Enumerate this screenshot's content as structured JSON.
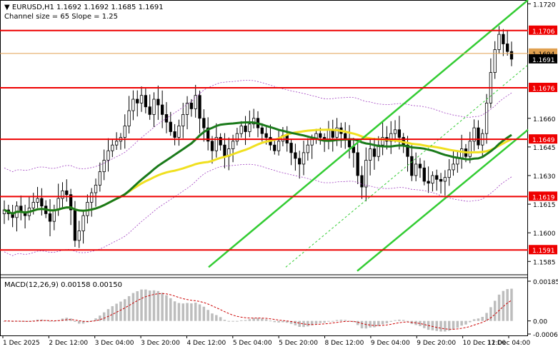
{
  "header": {
    "symbol_line": "▼ EURUSD,H1  1.1692 1.1692 1.1685 1.1691",
    "channel_line": "Channel size = 65 Slope = 1.25"
  },
  "macd_label": "MACD(12,26,9) 0.00158 0.00150",
  "price_scale": {
    "ticks": [
      "1.1720",
      "1.1660",
      "1.1645",
      "1.1630",
      "1.1615",
      "1.1600",
      "1.1585"
    ],
    "macd_ticks": [
      "0.00185",
      "0.00",
      "-0.00061"
    ]
  },
  "levels": [
    {
      "label": "1.1706",
      "value": 1.1706
    },
    {
      "label": "1.1676",
      "value": 1.1676
    },
    {
      "label": "1.1649",
      "value": 1.1649
    },
    {
      "label": "1.1619",
      "value": 1.1619
    },
    {
      "label": "1.1591",
      "value": 1.1591
    }
  ],
  "markers": [
    {
      "label": "1.1694",
      "value": 1.1694,
      "color": "#e0a050"
    },
    {
      "label": "1.1691",
      "value": 1.1691,
      "color": "#000000"
    }
  ],
  "time_axis": [
    "1 Dec 2025",
    "2 Dec 12:00",
    "3 Dec 04:00",
    "3 Dec 20:00",
    "4 Dec 12:00",
    "5 Dec 04:00",
    "5 Dec 20:00",
    "8 Dec 12:00",
    "9 Dec 04:00",
    "9 Dec 20:00",
    "10 Dec 12:00",
    "11 Dec 04:00"
  ],
  "colors": {
    "level_line": "#ee0000",
    "channel": "#33cc33",
    "ma_fast": "#1a7a1a",
    "ma_slow": "#f0e020",
    "envelope": "#a040c0",
    "candle": "#000000",
    "macd_hist": "#bdbdbd",
    "macd_signal": "#cc0000"
  },
  "chart_data": {
    "type": "candlestick",
    "symbol": "EURUSD",
    "timeframe": "H1",
    "ohlc": {
      "open": 1.1692,
      "high": 1.1692,
      "low": 1.1685,
      "close": 1.1691
    },
    "ylim": [
      1.1578,
      1.1722
    ],
    "horizontal_levels": [
      1.1706,
      1.1676,
      1.1649,
      1.1619,
      1.1591
    ],
    "bid": 1.1691,
    "ask": 1.1694,
    "close_series": [
      1.1612,
      1.161,
      1.1608,
      1.1614,
      1.1611,
      1.1609,
      1.1613,
      1.1616,
      1.1618,
      1.1614,
      1.161,
      1.1606,
      1.1612,
      1.1618,
      1.1622,
      1.162,
      1.1612,
      1.1596,
      1.1601,
      1.1609,
      1.1616,
      1.1621,
      1.1625,
      1.1632,
      1.1638,
      1.1643,
      1.1646,
      1.1648,
      1.165,
      1.1656,
      1.1664,
      1.167,
      1.1668,
      1.1672,
      1.1666,
      1.1662,
      1.167,
      1.1667,
      1.1662,
      1.1658,
      1.1653,
      1.165,
      1.1656,
      1.1662,
      1.1668,
      1.1665,
      1.1672,
      1.166,
      1.1655,
      1.1648,
      1.1643,
      1.165,
      1.1646,
      1.164,
      1.1644,
      1.1648,
      1.1652,
      1.1656,
      1.1653,
      1.1657,
      1.166,
      1.1655,
      1.1652,
      1.165,
      1.1646,
      1.1643,
      1.1648,
      1.1651,
      1.1647,
      1.1642,
      1.1639,
      1.1636,
      1.1642,
      1.1646,
      1.1649,
      1.1652,
      1.165,
      1.1648,
      1.1654,
      1.165,
      1.1655,
      1.1652,
      1.1649,
      1.1645,
      1.1642,
      1.163,
      1.1624,
      1.1638,
      1.1644,
      1.164,
      1.1646,
      1.165,
      1.1648,
      1.1652,
      1.1654,
      1.165,
      1.1646,
      1.164,
      1.163,
      1.1636,
      1.1634,
      1.1627,
      1.1626,
      1.163,
      1.1628,
      1.1627,
      1.1629,
      1.1633,
      1.1636,
      1.1639,
      1.1644,
      1.164,
      1.1648,
      1.1655,
      1.1646,
      1.1652,
      1.1668,
      1.1684,
      1.1696,
      1.1704,
      1.1699,
      1.1695,
      1.1691
    ],
    "indicators": [
      {
        "name": "MACD(12,26,9)",
        "main": 0.00158,
        "signal": 0.0015
      },
      {
        "name": "Channel",
        "size": 65,
        "slope": 1.25
      }
    ],
    "macd_ylim": [
      -0.00061,
      0.00185
    ]
  }
}
